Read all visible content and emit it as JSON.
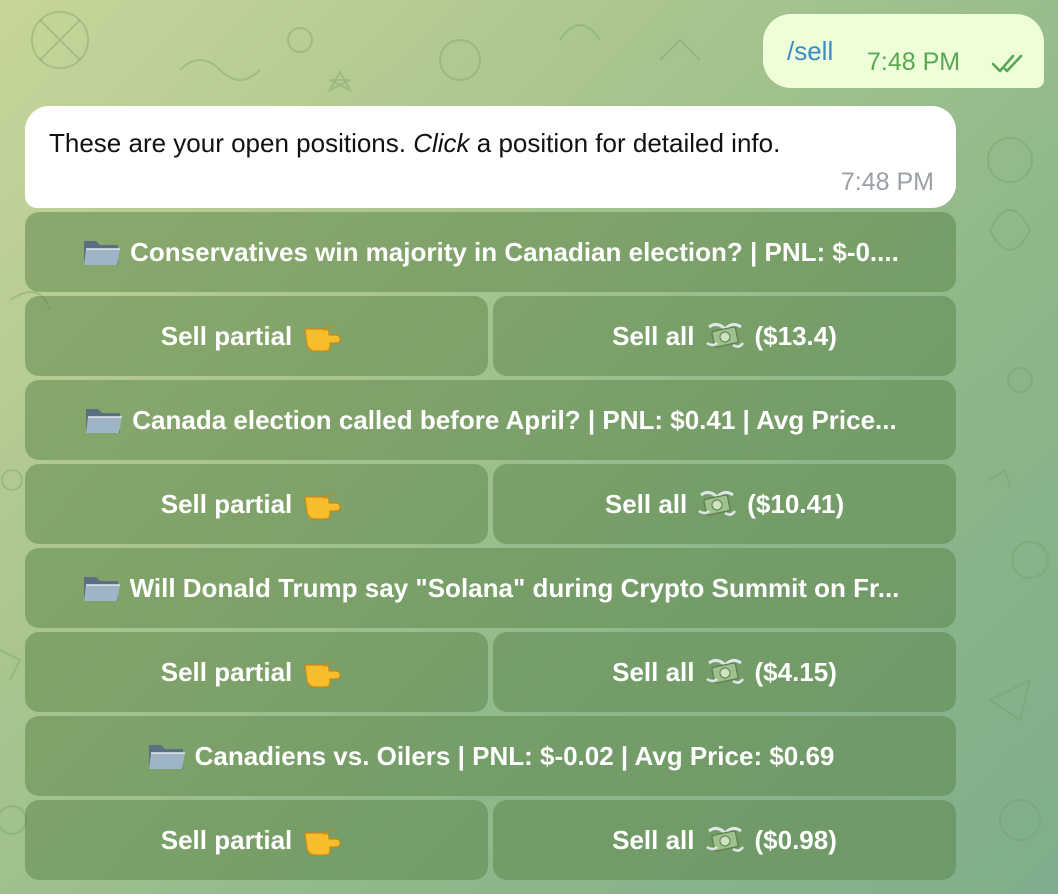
{
  "outgoing": {
    "text": "/sell",
    "time": "7:48 PM"
  },
  "incoming": {
    "text_before": "These are your open positions. ",
    "text_italic": "Click",
    "text_after": " a position for detailed info.",
    "time": "7:48 PM"
  },
  "positions": [
    {
      "title": "Conservatives win majority in Canadian election? | PNL: $-0....",
      "sell_partial": "Sell partial",
      "sell_all": "Sell all",
      "sell_all_amount": "($13.4)"
    },
    {
      "title": "Canada election called before April? | PNL: $0.41 | Avg Price...",
      "sell_partial": "Sell partial",
      "sell_all": "Sell all",
      "sell_all_amount": "($10.41)"
    },
    {
      "title": "Will Donald Trump say \"Solana\" during Crypto Summit on Fr...",
      "sell_partial": "Sell partial",
      "sell_all": "Sell all",
      "sell_all_amount": "($4.15)"
    },
    {
      "title": "Canadiens vs. Oilers | PNL: $-0.02 | Avg Price: $0.69",
      "sell_partial": "Sell partial",
      "sell_all": "Sell all",
      "sell_all_amount": "($0.98)"
    }
  ],
  "icons": {
    "position": "folder-icon",
    "sell_partial": "pointing-hand-icon",
    "sell_all": "flying-money-icon",
    "read_status": "double-check-icon"
  },
  "colors": {
    "outgoing_bubble": "#eefed9",
    "outgoing_text": "#3a8bc6",
    "outgoing_time": "#5aa752",
    "incoming_bubble": "#ffffff",
    "button_bg": "rgba(90,130,70,0.50)"
  }
}
